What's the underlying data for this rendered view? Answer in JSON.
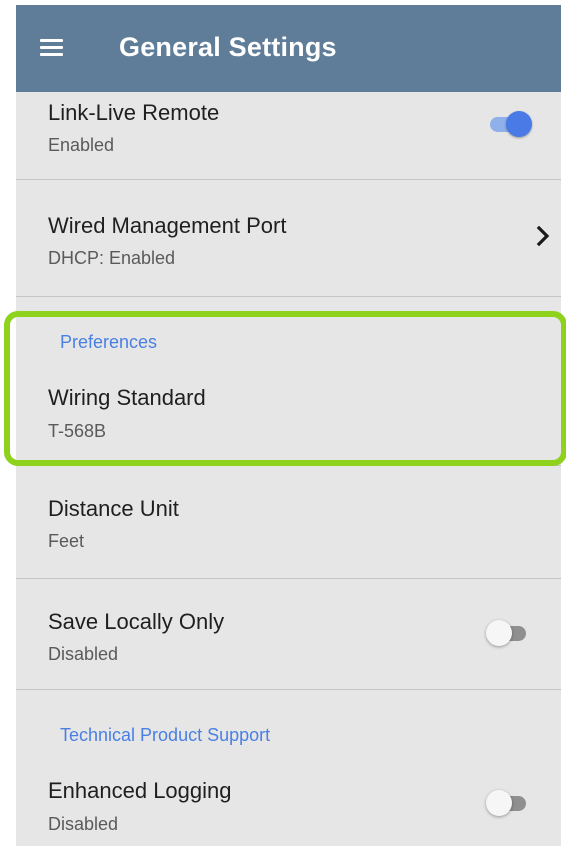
{
  "header": {
    "title": "General Settings",
    "menu_icon": "hamburger-menu-icon"
  },
  "settings": [
    {
      "title": "Link-Live Remote",
      "subtitle": "Enabled",
      "control": "toggle",
      "on": true
    },
    {
      "title": "Wired Management Port",
      "subtitle": "DHCP: Enabled",
      "control": "chevron"
    },
    {
      "category": "Preferences",
      "title": "Wiring Standard",
      "subtitle": "T-568B"
    },
    {
      "title": "Distance Unit",
      "subtitle": "Feet"
    },
    {
      "title": "Save Locally Only",
      "subtitle": "Disabled",
      "control": "toggle",
      "on": false
    },
    {
      "category": "Technical Product Support",
      "title": "Enhanced Logging",
      "subtitle": "Disabled",
      "control": "toggle",
      "on": false
    }
  ],
  "colors": {
    "app_bar": "#5f7d99",
    "background": "#e6e6e6",
    "accent": "#4a7ae6",
    "category_text": "#4a7fe3",
    "highlight_outline": "#8fd21c"
  }
}
